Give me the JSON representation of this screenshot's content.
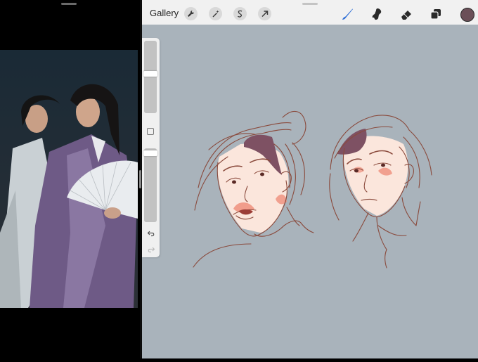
{
  "topbar": {
    "gallery_label": "Gallery",
    "left_tools": [
      "wrench-icon",
      "magic-wand-icon",
      "selection-icon",
      "transform-arrow-icon"
    ],
    "right_tools": [
      "brush-icon",
      "smudge-icon",
      "eraser-icon",
      "layers-icon"
    ],
    "current_color": "#6b5058"
  },
  "colors": {
    "canvas_background": "#a9b3bb",
    "skin": "#fbe6dc",
    "hair": "#7e5163",
    "line": "#8a4a3c",
    "blush": "#ef8f7c",
    "brush_active": "#2f6fd6"
  },
  "sidebar": {
    "brush_size": 0.7,
    "opacity": 0.93
  }
}
